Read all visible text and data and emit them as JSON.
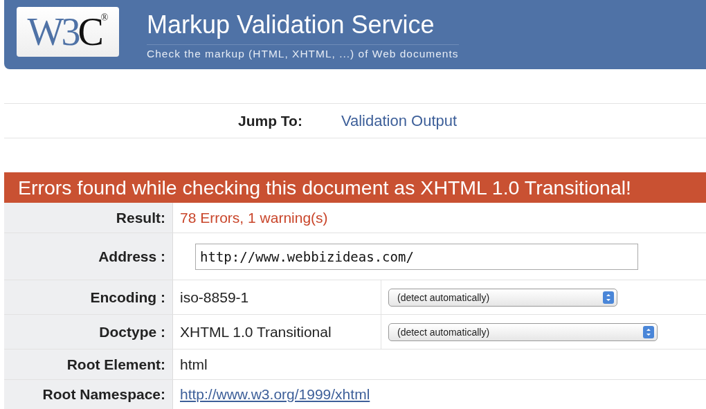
{
  "header": {
    "logo": {
      "main": "W3",
      "accent": "C",
      "mark": "®"
    },
    "title": "Markup Validation Service",
    "subtitle": "Check the markup (HTML, XHTML, ...) of Web documents"
  },
  "jump": {
    "label": "Jump To:",
    "link": "Validation Output"
  },
  "banner": "Errors found while checking this document as XHTML 1.0 Transitional!",
  "rows": [
    {
      "kind": "error",
      "label": "Result:",
      "value": "78 Errors, 1 warning(s)"
    },
    {
      "kind": "field",
      "label": "Address :",
      "value": "http://www.webbizideas.com/"
    },
    {
      "kind": "select",
      "label": "Encoding :",
      "value": "iso-8859-1",
      "select": "(detect automatically)",
      "wide": false
    },
    {
      "kind": "select",
      "label": "Doctype :",
      "value": "XHTML 1.0 Transitional",
      "select": "(detect automatically)",
      "wide": true
    },
    {
      "kind": "text",
      "label": "Root Element:",
      "value": "html"
    },
    {
      "kind": "link",
      "label": "Root Namespace:",
      "value": "http://www.w3.org/1999/xhtml"
    }
  ]
}
